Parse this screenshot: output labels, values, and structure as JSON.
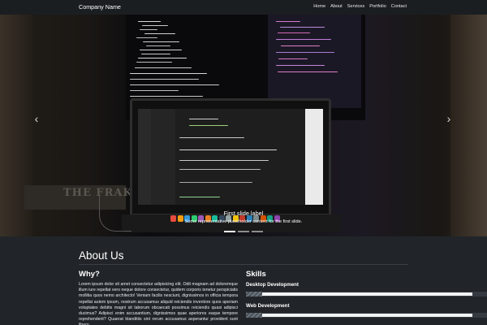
{
  "navbar": {
    "brand": "Company Name",
    "links": [
      "Home",
      "About",
      "Services",
      "Portfolio",
      "Contact"
    ]
  },
  "carousel": {
    "prev_icon": "chevron-left-icon",
    "next_icon": "chevron-right-icon",
    "caption_title": "First slide label",
    "caption_text": "Some representative placeholder content for the first slide.",
    "shelf_text": "THE FRAKE"
  },
  "about": {
    "title": "About Us",
    "why_title": "Why?",
    "why_text": "Lorem ipsum dolor sit amet consectetur adipisicing elit. Odit magnam ad doloremque illum iure repellat vero neque dolore consectetur, quidem corporis tenetur perspiciatis mollitia quos nemo architecto! Veniam facilis nesciunt, dignissimos in officia tempora repellat autem ipsum, nostrum accusamus aliquid reiciendis inventore quos aperiam voluptates debitis magni sit laborum obcaecati possimus reiciendis quasi adipisci ducimus? Adipisci enim accusantium, dignissimos quae aperiores eaque tempore reprehenderit? Quaerat blanditiis sint rerum accusamus asperantur provident sunt libero",
    "skills_title": "Skills",
    "skills": [
      {
        "name": "Desktop Development",
        "level": 0.94
      },
      {
        "name": "Web Development",
        "level": 0.94
      }
    ]
  },
  "colors": {
    "background": "#212529",
    "navbar": "#1b1e21",
    "progress_fill": "#f1f3f5"
  }
}
